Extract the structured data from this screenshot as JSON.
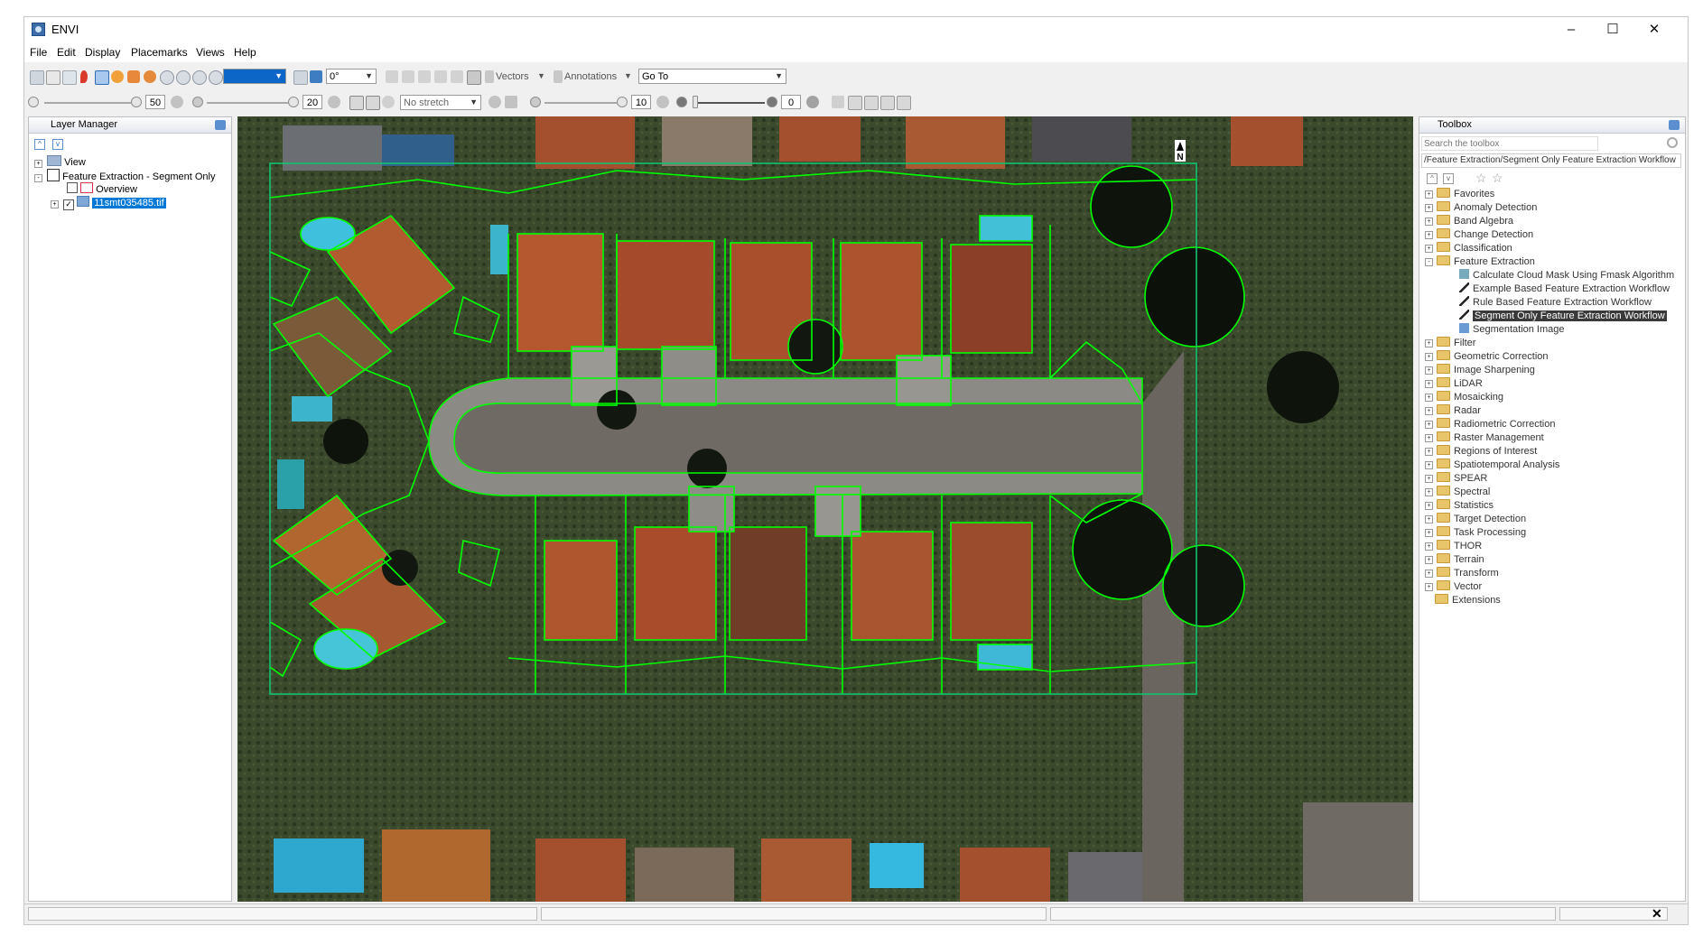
{
  "window": {
    "title": "ENVI",
    "minimize": "–",
    "maximize": "☐",
    "close": "✕"
  },
  "menu": [
    "File",
    "Edit",
    "Display",
    "Placemarks",
    "Views",
    "Help"
  ],
  "toolbar1": {
    "rotation_value": "0°",
    "vectors_label": "Vectors",
    "annotations_label": "Annotations",
    "goto_value": "Go To"
  },
  "toolbar2": {
    "brightness_value": "50",
    "contrast_value": "20",
    "stretch_value": "No stretch",
    "sharpen_value": "10",
    "transparency_value": "0"
  },
  "layer_manager": {
    "title": "Layer Manager",
    "items": [
      {
        "label": "View"
      },
      {
        "label": "Feature Extraction - Segment Only"
      },
      {
        "label": "Overview"
      },
      {
        "label": "11smt035485.tif"
      }
    ]
  },
  "toolbox": {
    "title": "Toolbox",
    "search_placeholder": "Search the toolbox",
    "path": "/Feature Extraction/Segment Only Feature Extraction Workflow",
    "items": [
      {
        "label": "Favorites"
      },
      {
        "label": "Anomaly Detection"
      },
      {
        "label": "Band Algebra"
      },
      {
        "label": "Change Detection"
      },
      {
        "label": "Classification"
      },
      {
        "label": "Feature Extraction"
      },
      {
        "label": "Calculate Cloud Mask Using Fmask Algorithm"
      },
      {
        "label": "Example Based Feature Extraction Workflow"
      },
      {
        "label": "Rule Based Feature Extraction Workflow"
      },
      {
        "label": "Segment Only Feature Extraction Workflow"
      },
      {
        "label": "Segmentation Image"
      },
      {
        "label": "Filter"
      },
      {
        "label": "Geometric Correction"
      },
      {
        "label": "Image Sharpening"
      },
      {
        "label": "LiDAR"
      },
      {
        "label": "Mosaicking"
      },
      {
        "label": "Radar"
      },
      {
        "label": "Radiometric Correction"
      },
      {
        "label": "Raster Management"
      },
      {
        "label": "Regions of Interest"
      },
      {
        "label": "Spatiotemporal Analysis"
      },
      {
        "label": "SPEAR"
      },
      {
        "label": "Spectral"
      },
      {
        "label": "Statistics"
      },
      {
        "label": "Target Detection"
      },
      {
        "label": "Task Processing"
      },
      {
        "label": "THOR"
      },
      {
        "label": "Terrain"
      },
      {
        "label": "Transform"
      },
      {
        "label": "Vector"
      },
      {
        "label": "Extensions"
      }
    ]
  },
  "image_view": {
    "north_arrow": "N"
  },
  "colors": {
    "segment_outline": "#00ff00",
    "selection": "#0078d7",
    "roof": "#a8502d",
    "road": "#6f6a64"
  }
}
